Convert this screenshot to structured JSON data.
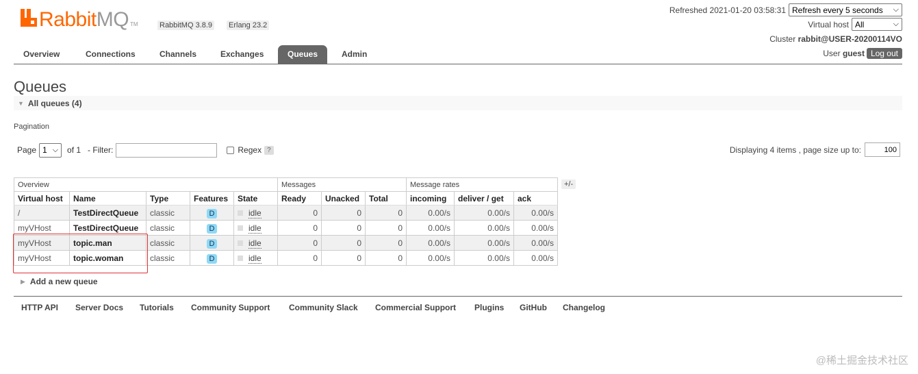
{
  "brand": {
    "name_part1": "Rabbit",
    "name_part2": "MQ",
    "tm": "TM",
    "rabbitmq_version": "RabbitMQ 3.8.9",
    "erlang_version": "Erlang 23.2",
    "accent_color": "#ff6600"
  },
  "header": {
    "refreshed_label": "Refreshed 2021-01-20 03:58:31",
    "refresh_select": "Refresh every 5 seconds",
    "vhost_label": "Virtual host",
    "vhost_select": "All",
    "cluster_label": "Cluster",
    "cluster_name": "rabbit@USER-20200114VO",
    "user_label": "User",
    "user_name": "guest",
    "logout_label": "Log out"
  },
  "nav": {
    "tabs": [
      "Overview",
      "Connections",
      "Channels",
      "Exchanges",
      "Queues",
      "Admin"
    ],
    "active": "Queues"
  },
  "page": {
    "title": "Queues",
    "section_title": "All queues (4)"
  },
  "pagination": {
    "label": "Pagination",
    "page_label": "Page",
    "page_value": "1",
    "of_label": "of 1",
    "filter_label": "- Filter:",
    "filter_value": "",
    "regex_label": "Regex",
    "regex_help": "?",
    "displaying_label": "Displaying 4 items , page size up to:",
    "page_size": "100"
  },
  "table": {
    "groups": [
      "Overview",
      "Messages",
      "Message rates"
    ],
    "columns_toggle": "+/-",
    "columns": [
      "Virtual host",
      "Name",
      "Type",
      "Features",
      "State",
      "Ready",
      "Unacked",
      "Total",
      "incoming",
      "deliver / get",
      "ack"
    ],
    "rows": [
      {
        "vhost": "/",
        "name": "TestDirectQueue",
        "type": "classic",
        "features": "D",
        "state": "idle",
        "ready": "0",
        "unacked": "0",
        "total": "0",
        "incoming": "0.00/s",
        "deliver": "0.00/s",
        "ack": "0.00/s"
      },
      {
        "vhost": "myVHost",
        "name": "TestDirectQueue",
        "type": "classic",
        "features": "D",
        "state": "idle",
        "ready": "0",
        "unacked": "0",
        "total": "0",
        "incoming": "0.00/s",
        "deliver": "0.00/s",
        "ack": "0.00/s"
      },
      {
        "vhost": "myVHost",
        "name": "topic.man",
        "type": "classic",
        "features": "D",
        "state": "idle",
        "ready": "0",
        "unacked": "0",
        "total": "0",
        "incoming": "0.00/s",
        "deliver": "0.00/s",
        "ack": "0.00/s"
      },
      {
        "vhost": "myVHost",
        "name": "topic.woman",
        "type": "classic",
        "features": "D",
        "state": "idle",
        "ready": "0",
        "unacked": "0",
        "total": "0",
        "incoming": "0.00/s",
        "deliver": "0.00/s",
        "ack": "0.00/s"
      }
    ]
  },
  "add_queue": {
    "label": "Add a new queue"
  },
  "footer": {
    "links": [
      "HTTP API",
      "Server Docs",
      "Tutorials",
      "Community Support",
      "Community Slack",
      "Commercial Support",
      "Plugins",
      "GitHub",
      "Changelog"
    ]
  },
  "watermark": "@稀土掘金技术社区"
}
